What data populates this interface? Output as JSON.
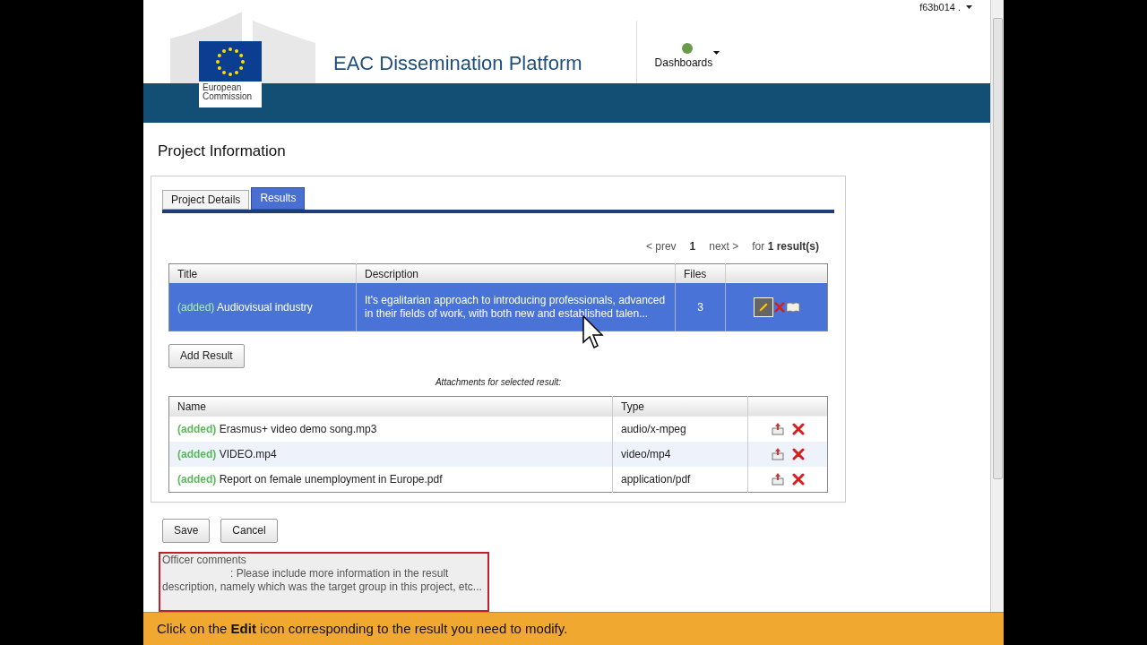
{
  "user_menu": {
    "label": "f63b014 ."
  },
  "header": {
    "org_line1": "European",
    "org_line2": "Commission",
    "title": "EAC Dissemination Platform",
    "nav": [
      {
        "label": "Dashboards"
      }
    ]
  },
  "page_title": "Project Information",
  "tabs": [
    {
      "label": "Project Details",
      "selected": false
    },
    {
      "label": "Results",
      "selected": true
    }
  ],
  "pager": {
    "prev": "< prev",
    "page": "1",
    "next": "next >",
    "summary_prefix": "for",
    "summary_count": "1 result(s)"
  },
  "results": {
    "columns": [
      "Title",
      "Description",
      "Files"
    ],
    "rows": [
      {
        "status": "(added)",
        "title": "Audiovisual industry",
        "description": "It's egalitarian approach to introducing professionals, advanced in their fields of work, with both new and established talen...",
        "files": "3",
        "selected": true
      }
    ]
  },
  "add_button": "Add Result",
  "attachments": {
    "caption": "Attachments for selected result:",
    "columns": [
      "Name",
      "Type"
    ],
    "rows": [
      {
        "status": "(added)",
        "name": "Erasmus+ video demo song.mp3",
        "type": "audio/x-mpeg"
      },
      {
        "status": "(added)",
        "name": "VIDEO.mp4",
        "type": "video/mp4"
      },
      {
        "status": "(added)",
        "name": "Report on female unemployment in Europe.pdf",
        "type": "application/pdf"
      }
    ]
  },
  "buttons": [
    "Save",
    "Cancel"
  ],
  "officer_comments": {
    "label": "Officer comments",
    "text": ": Please include more information in the result description, namely which was the target group in this project, etc..."
  },
  "hint_bar": "Click on the **Edit** icon corresponding to the result you need to modify."
}
